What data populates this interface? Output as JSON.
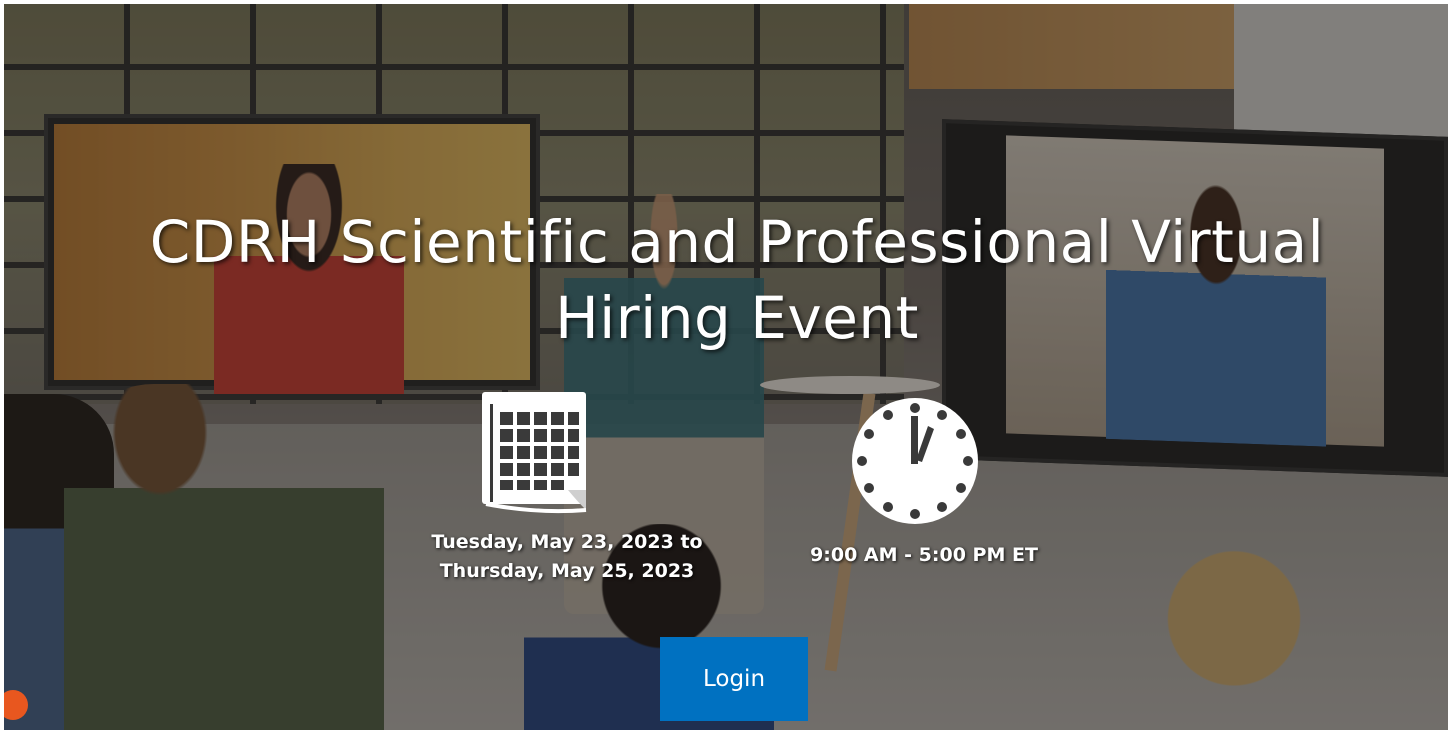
{
  "hero": {
    "title": "CDRH Scientific and Professional Virtual Hiring Event",
    "background_image": "people-in-video-conference-office-photo"
  },
  "event": {
    "date_line_1": "Tuesday, May 23, 2023 to",
    "date_line_2": "Thursday, May 25, 2023",
    "time": "9:00 AM - 5:00 PM ET",
    "calendar_icon": "calendar-icon",
    "clock_icon": "clock-icon"
  },
  "actions": {
    "login_label": "Login"
  },
  "colors": {
    "accent": "#0071c1",
    "text": "#ffffff",
    "overlay": "#1e1c1a",
    "chat_badge": "#e8571f"
  }
}
